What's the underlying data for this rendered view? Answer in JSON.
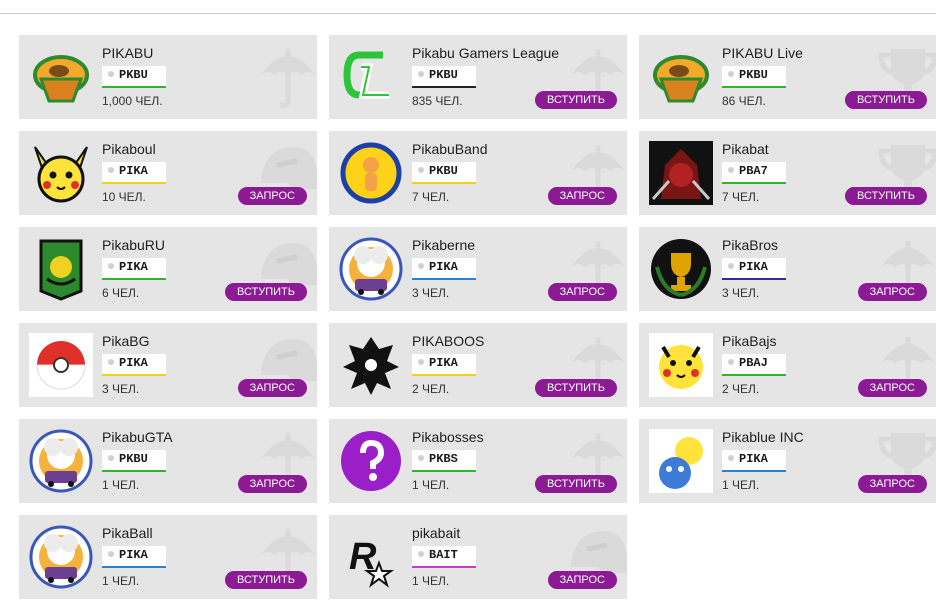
{
  "groups": [
    {
      "name": "PIKABU",
      "tag": "PKBU",
      "tag_color": "#33b233",
      "members": "1,000 ЧЕЛ.",
      "action": "",
      "logo": "cupcake-logo"
    },
    {
      "name": "Pikabu Gamers League",
      "tag": "PKBU",
      "tag_color": "#222222",
      "members": "835 ЧЕЛ.",
      "action": "ВСТУПИТЬ",
      "logo": "gl-logo"
    },
    {
      "name": "PIKABU Live",
      "tag": "PKBU",
      "tag_color": "#33b233",
      "members": "86 ЧЕЛ.",
      "action": "ВСТУПИТЬ",
      "logo": "cupcake-logo"
    },
    {
      "name": "Pikaboul",
      "tag": "PIKA",
      "tag_color": "#f0d020",
      "members": "10 ЧЕЛ.",
      "action": "ЗАПРОС",
      "logo": "pikachu-face-logo"
    },
    {
      "name": "PikabuBand",
      "tag": "PKBU",
      "tag_color": "#f0d020",
      "members": "7 ЧЕЛ.",
      "action": "ЗАПРОС",
      "logo": "band-logo"
    },
    {
      "name": "Pikabat",
      "tag": "PBA7",
      "tag_color": "#33b233",
      "members": "7 ЧЕЛ.",
      "action": "ВСТУПИТЬ",
      "logo": "warrior-logo"
    },
    {
      "name": "PikabuRU",
      "tag": "PIKA",
      "tag_color": "#33b233",
      "members": "6 ЧЕЛ.",
      "action": "ВСТУПИТЬ",
      "logo": "shield-logo"
    },
    {
      "name": "Pikaberne",
      "tag": "PIKA",
      "tag_color": "#2f7fd0",
      "members": "3 ЧЕЛ.",
      "action": "ЗАПРОС",
      "logo": "explosion-car-logo"
    },
    {
      "name": "PikaBros",
      "tag": "PIKA",
      "tag_color": "#3a2a8c",
      "members": "3 ЧЕЛ.",
      "action": "ЗАПРОС",
      "logo": "trophy-logo"
    },
    {
      "name": "PikaBG",
      "tag": "PIKA",
      "tag_color": "#f0d020",
      "members": "3 ЧЕЛ.",
      "action": "ЗАПРОС",
      "logo": "pokeball-logo"
    },
    {
      "name": "PIKABOOS",
      "tag": "PIKA",
      "tag_color": "#f0d020",
      "members": "2 ЧЕЛ.",
      "action": "ВСТУПИТЬ",
      "logo": "ornament-logo"
    },
    {
      "name": "PikaBajs",
      "tag": "PBAJ",
      "tag_color": "#33b233",
      "members": "2 ЧЕЛ.",
      "action": "ЗАПРОС",
      "logo": "pikachu-logo"
    },
    {
      "name": "PikabuGTA",
      "tag": "PKBU",
      "tag_color": "#33b233",
      "members": "1 ЧЕЛ.",
      "action": "ЗАПРОС",
      "logo": "explosion-car-logo"
    },
    {
      "name": "Pikabosses",
      "tag": "PKBS",
      "tag_color": "#33b233",
      "members": "1 ЧЕЛ.",
      "action": "ВСТУПИТЬ",
      "logo": "question-logo"
    },
    {
      "name": "Pikablue INC",
      "tag": "PIKA",
      "tag_color": "#2f7fd0",
      "members": "1 ЧЕЛ.",
      "action": "ЗАПРОС",
      "logo": "pikablue-logo"
    },
    {
      "name": "PikaBall",
      "tag": "PIKA",
      "tag_color": "#2f7fd0",
      "members": "1 ЧЕЛ.",
      "action": "ВСТУПИТЬ",
      "logo": "explosion-car-logo"
    },
    {
      "name": "pikabait",
      "tag": "BAIT",
      "tag_color": "#c040c0",
      "members": "1 ЧЕЛ.",
      "action": "ЗАПРОС",
      "logo": "rockstar-logo"
    }
  ]
}
